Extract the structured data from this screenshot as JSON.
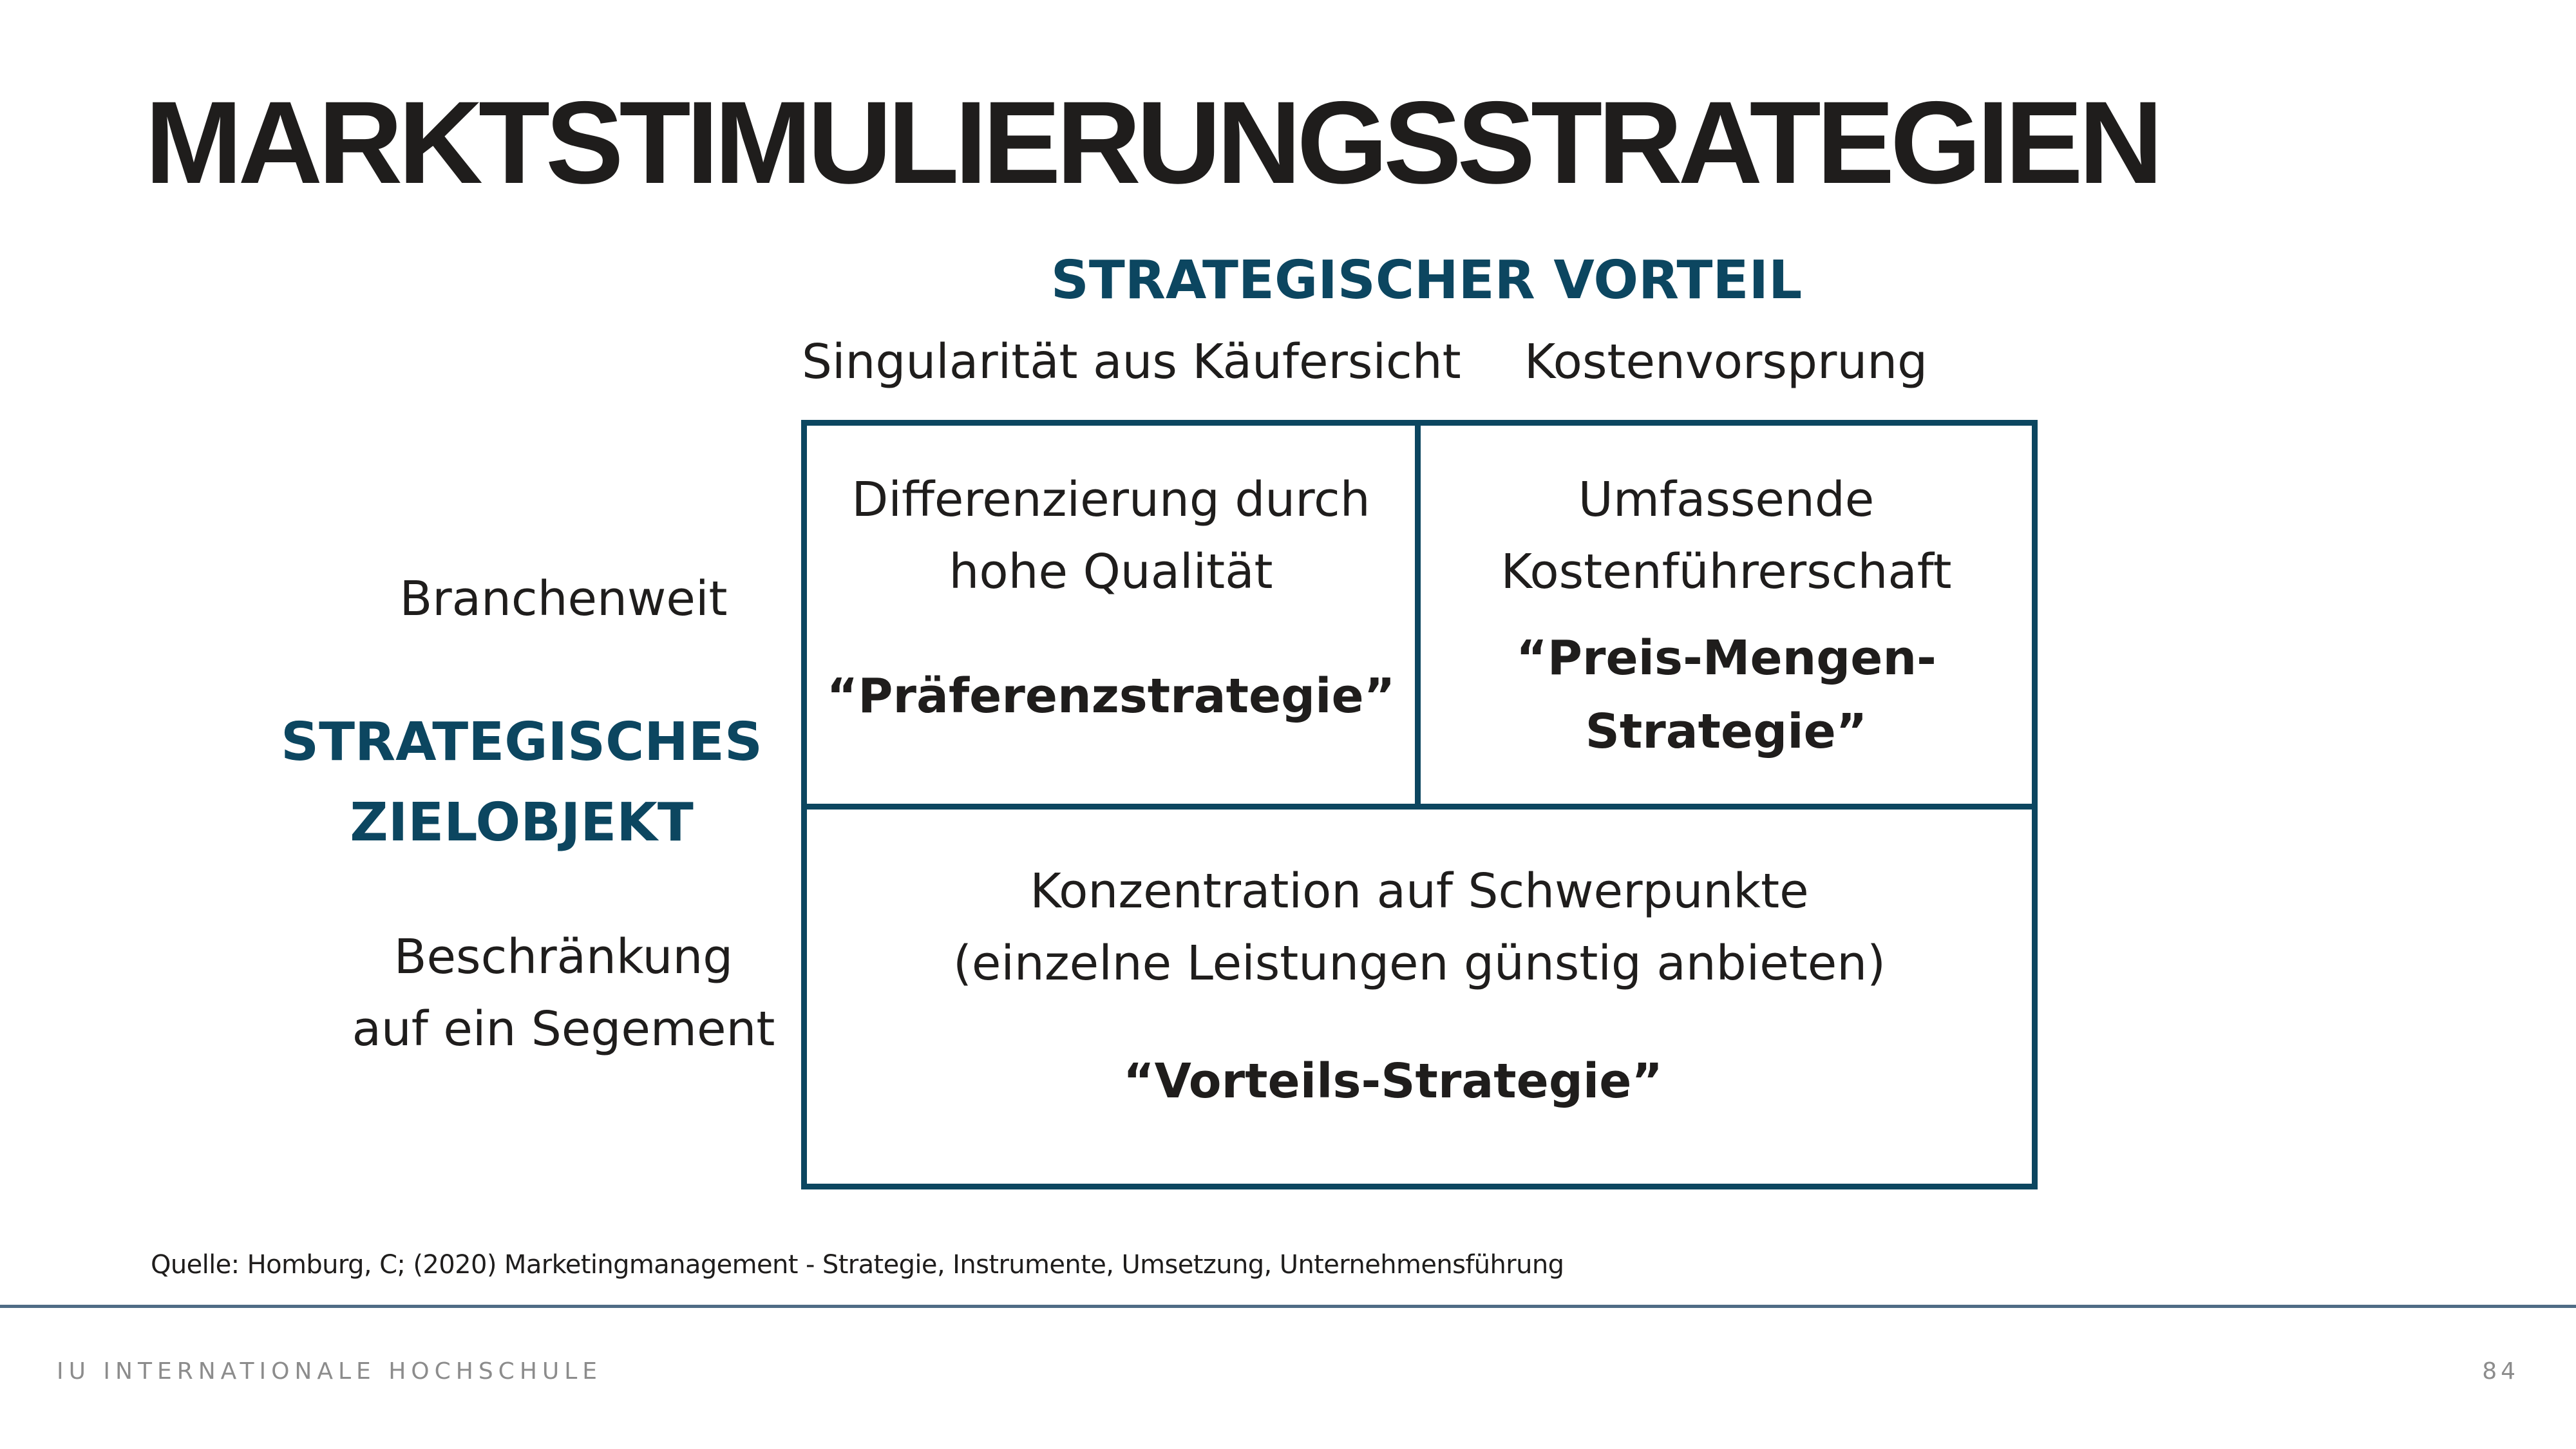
{
  "slide": {
    "title": "MARKTSTIMULIERUNGSSTRATEGIEN"
  },
  "matrix": {
    "top_axis": {
      "title": "STRATEGISCHER VORTEIL",
      "columns": [
        "Singularität aus Käufersicht",
        "Kostenvorsprung"
      ]
    },
    "left_axis": {
      "title_lines": [
        "STRATEGISCHES",
        "ZIELOBJEKT"
      ],
      "rows": [
        [
          "Branchenweit"
        ],
        [
          "Beschränkung",
          "auf ein Segement"
        ]
      ]
    },
    "cells": [
      {
        "description_lines": [
          "Differenzierung durch",
          "hohe Qualität"
        ],
        "name_lines": [
          "“Präferenzstrategie”"
        ]
      },
      {
        "description_lines": [
          "Umfassende",
          "Kostenführerschaft"
        ],
        "name_lines": [
          "“Preis-Mengen-",
          "Strategie”"
        ]
      },
      {
        "description_lines": [
          "Konzentration auf Schwerpunkte",
          "(einzelne Leistungen günstig anbieten)"
        ],
        "name_lines": [
          "“Vorteils-Strategie”"
        ]
      }
    ]
  },
  "source": "Quelle: Homburg, C; (2020) Marketingmanagement - Strategie, Instrumente, Umsetzung, Unternehmensführung",
  "footer": {
    "institution": "IU INTERNATIONALE HOCHSCHULE",
    "page_number": "84"
  },
  "colors": {
    "accent": "#0c4660",
    "text": "#1f1d1c",
    "footer_text": "#8c8c8c",
    "footer_line": "#4f6c85"
  }
}
